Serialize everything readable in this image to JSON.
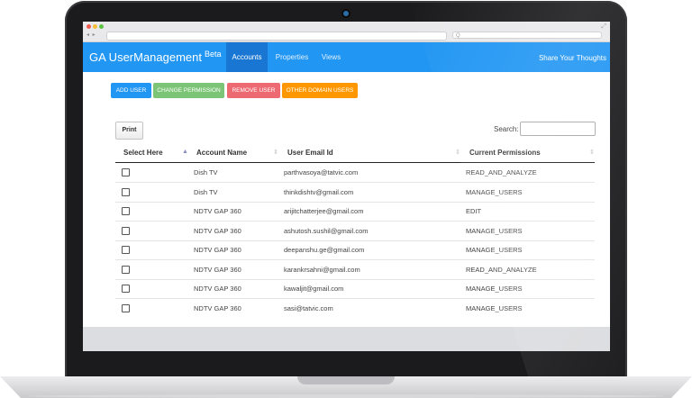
{
  "browser": {
    "search_placeholder": "Q"
  },
  "header": {
    "brand": "GA UserManagement",
    "brand_badge": "Beta",
    "tabs": [
      {
        "label": "Accounts",
        "active": true
      },
      {
        "label": "Properties",
        "active": false
      },
      {
        "label": "Views",
        "active": false
      }
    ],
    "share": "Share Your Thoughts"
  },
  "actions": [
    {
      "label": "ADD USER",
      "color": "#2196f3"
    },
    {
      "label": "CHANGE PERMISSION",
      "color": "#7cc576"
    },
    {
      "label": "REMOVE USER",
      "color": "#ee6a72"
    },
    {
      "label": "OTHER DOMAIN USERS",
      "color": "#ff9800"
    }
  ],
  "print_label": "Print",
  "search_label": "Search:",
  "columns": [
    "Select Here",
    "Account Name",
    "User Email Id",
    "Current Permissions"
  ],
  "rows": [
    {
      "account": "Dish TV",
      "email": "parthvasoya@tatvic.com",
      "permission": "READ_AND_ANALYZE"
    },
    {
      "account": "Dish TV",
      "email": "thinkdishtv@gmail.com",
      "permission": "MANAGE_USERS"
    },
    {
      "account": "NDTV GAP 360",
      "email": "arijitchatterjee@gmail.com",
      "permission": "EDIT"
    },
    {
      "account": "NDTV GAP 360",
      "email": "ashutosh.sushil@gmail.com",
      "permission": "MANAGE_USERS"
    },
    {
      "account": "NDTV GAP 360",
      "email": "deepanshu.ge@gmail.com",
      "permission": "MANAGE_USERS"
    },
    {
      "account": "NDTV GAP 360",
      "email": "karankrsahni@gmail.com",
      "permission": "READ_AND_ANALYZE"
    },
    {
      "account": "NDTV GAP 360",
      "email": "kawaljit@gmail.com",
      "permission": "MANAGE_USERS"
    },
    {
      "account": "NDTV GAP 360",
      "email": "sasi@tatvic.com",
      "permission": "MANAGE_USERS"
    }
  ]
}
